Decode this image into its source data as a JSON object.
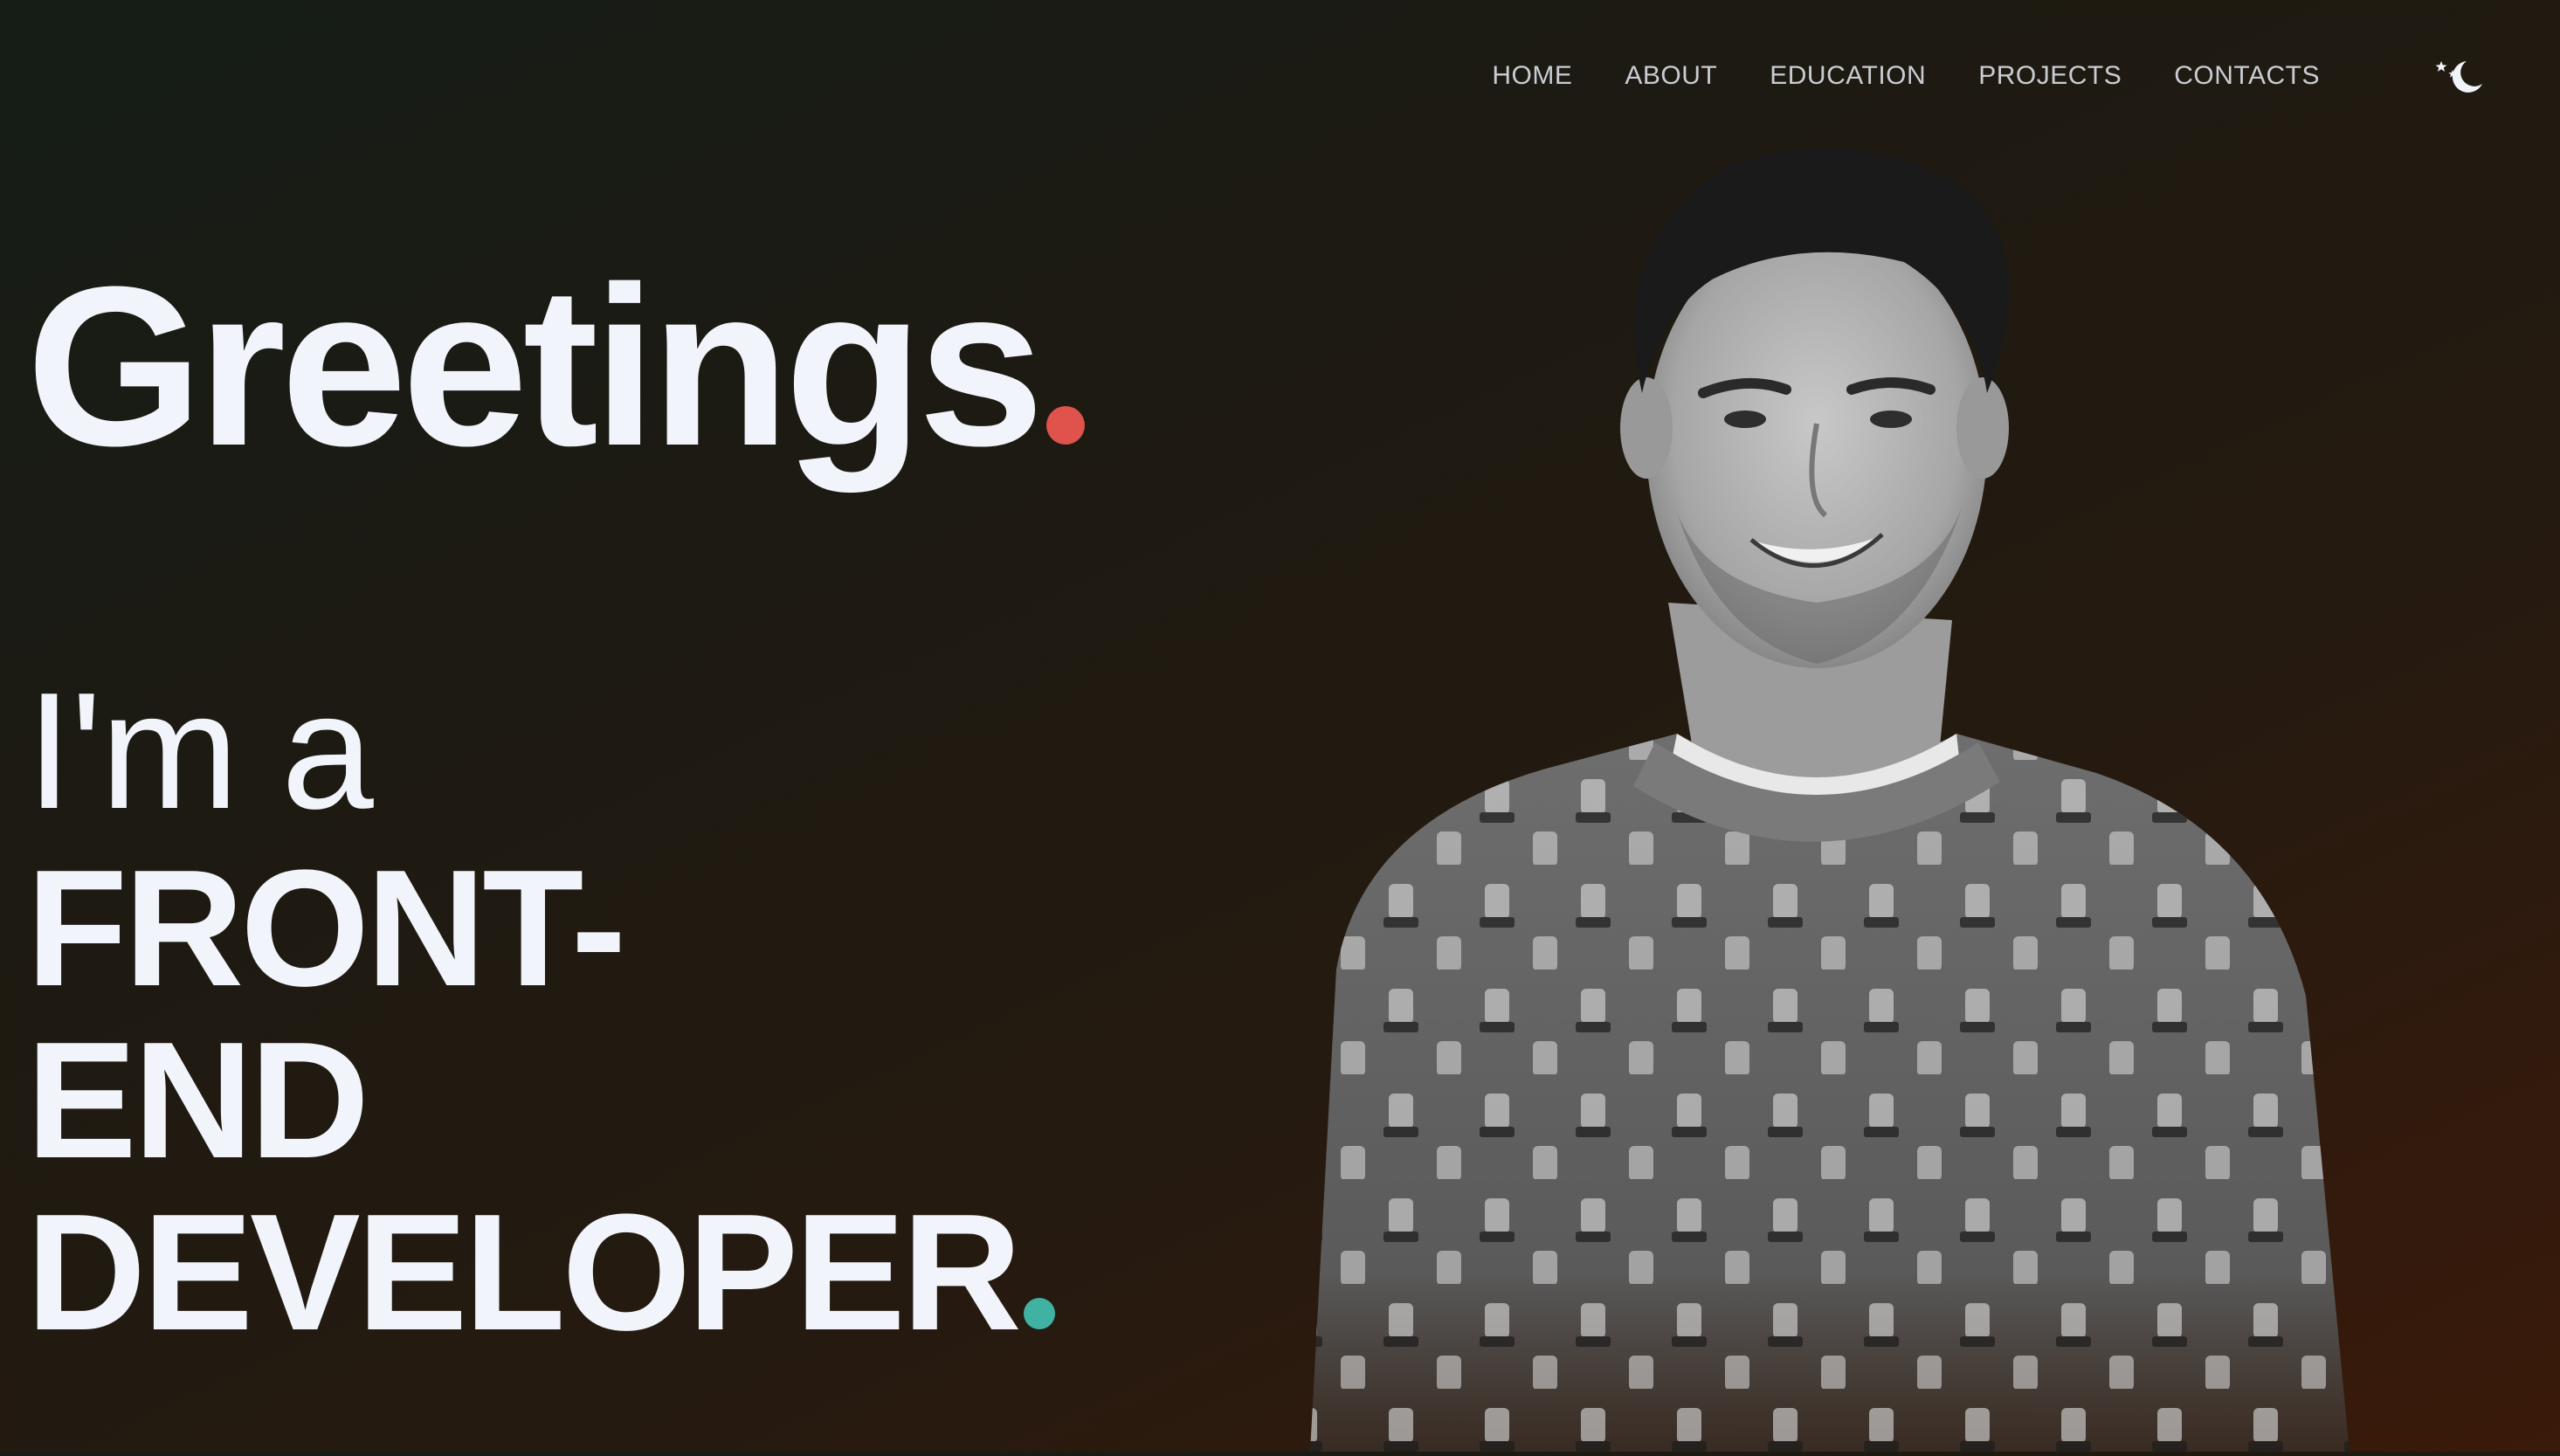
{
  "nav": {
    "items": [
      {
        "label": "HOME"
      },
      {
        "label": "ABOUT"
      },
      {
        "label": "EDUCATION"
      },
      {
        "label": "PROJECTS"
      },
      {
        "label": "CONTACTS"
      }
    ],
    "theme_toggle_icon": "moon-stars-icon"
  },
  "hero": {
    "greeting": "Greetings",
    "intro": "I'm a",
    "role_lines": [
      "FRONT-",
      "END",
      "DEVELOPER"
    ]
  },
  "portrait": {
    "icon": "person-portrait"
  },
  "colors": {
    "accent_red": "#e0524c",
    "accent_teal": "#3fb2a3",
    "text": "#f1f4fa",
    "nav_text": "#c9ccd2"
  }
}
